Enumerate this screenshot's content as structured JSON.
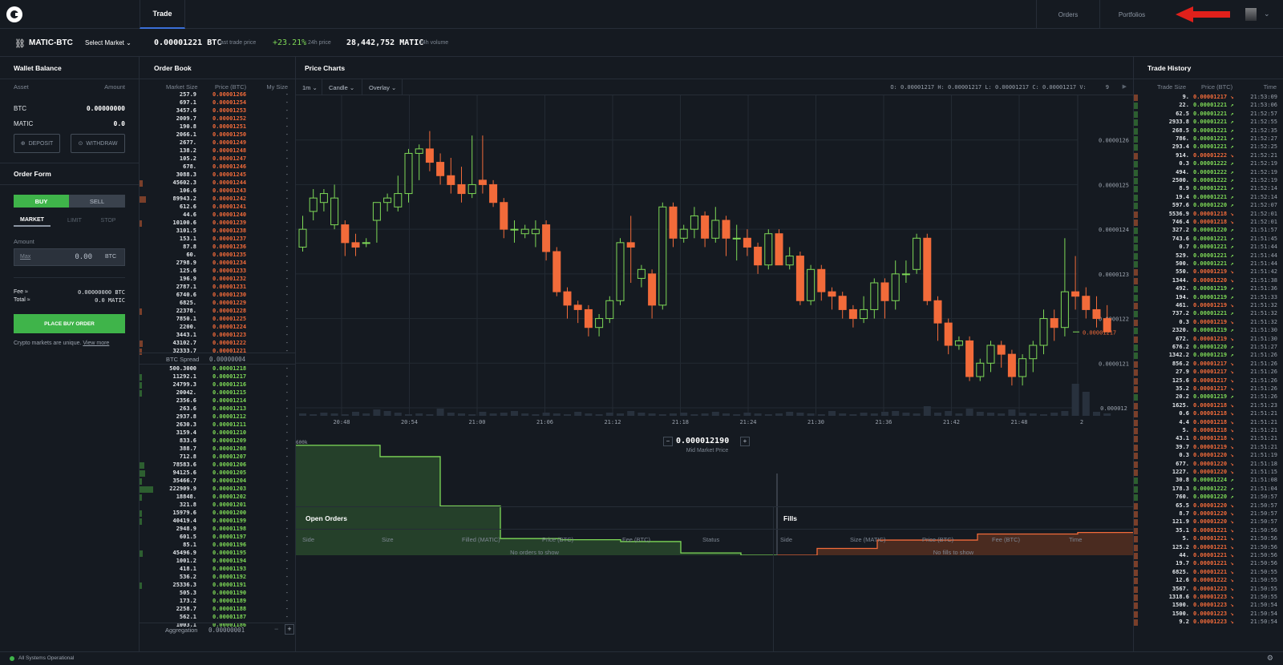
{
  "nav": {
    "tab_trade": "Trade",
    "orders": "Orders",
    "portfolios": "Portfolios"
  },
  "market": {
    "pair": "MATIC-BTC",
    "select_label": "Select Market",
    "last_price": "0.00001221 BTC",
    "last_price_label": "Last trade price",
    "change": "+23.21%",
    "change_label": "24h price",
    "volume": "28,442,752 MATIC",
    "volume_label": "24h volume"
  },
  "wallet": {
    "title": "Wallet Balance",
    "col_asset": "Asset",
    "col_amount": "Amount",
    "rows": [
      {
        "asset": "BTC",
        "amount": "0.00000000"
      },
      {
        "asset": "MATIC",
        "amount": "0.0"
      }
    ],
    "deposit": "DEPOSIT",
    "withdraw": "WITHDRAW"
  },
  "order_form": {
    "title": "Order Form",
    "buy": "BUY",
    "sell": "SELL",
    "market": "MARKET",
    "limit": "LIMIT",
    "stop": "STOP",
    "amount_label": "Amount",
    "max": "Max",
    "amount_value": "0.00",
    "amount_unit": "BTC",
    "fee_label": "Fee ≈",
    "fee_value": "0.00000000 BTC",
    "total_label": "Total ≈",
    "total_value": "0.0 MATIC",
    "place": "PLACE BUY ORDER",
    "note": "Crypto markets are unique.",
    "note_link": "View more"
  },
  "order_book": {
    "title": "Order Book",
    "col_size": "Market Size",
    "col_price": "Price (BTC)",
    "col_my": "My Size",
    "asks": [
      [
        "257.9",
        "0.00001266",
        0
      ],
      [
        "697.1",
        "0.00001254",
        0
      ],
      [
        "3457.6",
        "0.00001253",
        0
      ],
      [
        "2009.7",
        "0.00001252",
        0
      ],
      [
        "190.8",
        "0.00001251",
        0
      ],
      [
        "2066.1",
        "0.00001250",
        0
      ],
      [
        "2677.",
        "0.00001249",
        0
      ],
      [
        "138.2",
        "0.00001248",
        0
      ],
      [
        "105.2",
        "0.00001247",
        0
      ],
      [
        "678.",
        "0.00001246",
        0
      ],
      [
        "3088.3",
        "0.00001245",
        0
      ],
      [
        "45602.3",
        "0.00001244",
        0.04
      ],
      [
        "106.6",
        "0.00001243",
        0
      ],
      [
        "89943.2",
        "0.00001242",
        0.08
      ],
      [
        "612.6",
        "0.00001241",
        0
      ],
      [
        "44.6",
        "0.00001240",
        0
      ],
      [
        "10100.6",
        "0.00001239",
        0.01
      ],
      [
        "3101.5",
        "0.00001238",
        0
      ],
      [
        "153.1",
        "0.00001237",
        0
      ],
      [
        "87.8",
        "0.00001236",
        0
      ],
      [
        "60.",
        "0.00001235",
        0
      ],
      [
        "2798.9",
        "0.00001234",
        0
      ],
      [
        "125.6",
        "0.00001233",
        0
      ],
      [
        "196.9",
        "0.00001232",
        0
      ],
      [
        "2787.1",
        "0.00001231",
        0
      ],
      [
        "6740.6",
        "0.00001230",
        0
      ],
      [
        "6825.",
        "0.00001229",
        0
      ],
      [
        "22378.",
        "0.00001228",
        0.02
      ],
      [
        "7850.1",
        "0.00001225",
        0
      ],
      [
        "2200.",
        "0.00001224",
        0
      ],
      [
        "3443.1",
        "0.00001223",
        0
      ],
      [
        "43102.7",
        "0.00001222",
        0.04
      ],
      [
        "32333.7",
        "0.00001221",
        0.03
      ]
    ],
    "spread_label": "BTC Spread",
    "spread": "0.00000004",
    "bids": [
      [
        "500.3000",
        "0.00001218",
        0
      ],
      [
        "11292.1",
        "0.00001217",
        0.01
      ],
      [
        "24799.3",
        "0.00001216",
        0.02
      ],
      [
        "20042.",
        "0.00001215",
        0.02
      ],
      [
        "2356.6",
        "0.00001214",
        0
      ],
      [
        "263.6",
        "0.00001213",
        0
      ],
      [
        "2937.8",
        "0.00001212",
        0
      ],
      [
        "2630.3",
        "0.00001211",
        0
      ],
      [
        "3159.4",
        "0.00001210",
        0
      ],
      [
        "833.6",
        "0.00001209",
        0
      ],
      [
        "388.7",
        "0.00001208",
        0
      ],
      [
        "712.8",
        "0.00001207",
        0
      ],
      [
        "78583.6",
        "0.00001206",
        0.06
      ],
      [
        "94125.6",
        "0.00001205",
        0.07
      ],
      [
        "35466.7",
        "0.00001204",
        0.03
      ],
      [
        "222909.9",
        "0.00001203",
        0.17
      ],
      [
        "18848.",
        "0.00001202",
        0.02
      ],
      [
        "321.8",
        "0.00001201",
        0
      ],
      [
        "15979.6",
        "0.00001200",
        0.01
      ],
      [
        "40419.4",
        "0.00001199",
        0.03
      ],
      [
        "2948.9",
        "0.00001198",
        0
      ],
      [
        "601.5",
        "0.00001197",
        0
      ],
      [
        "85.1",
        "0.00001196",
        0
      ],
      [
        "45496.9",
        "0.00001195",
        0.04
      ],
      [
        "1001.2",
        "0.00001194",
        0
      ],
      [
        "418.1",
        "0.00001193",
        0
      ],
      [
        "536.2",
        "0.00001192",
        0
      ],
      [
        "25336.3",
        "0.00001191",
        0.02
      ],
      [
        "505.3",
        "0.00001190",
        0
      ],
      [
        "173.2",
        "0.00001189",
        0
      ],
      [
        "2258.7",
        "0.00001188",
        0
      ],
      [
        "562.1",
        "0.00001187",
        0
      ],
      [
        "1003.1",
        "0.00001186",
        0
      ]
    ],
    "my_size": "-",
    "aggregation_label": "Aggregation",
    "aggregation": "0.00000001",
    "minus": "−",
    "plus": "+"
  },
  "price_chart": {
    "title": "Price Charts",
    "interval": "1m",
    "type_label": "Candle",
    "overlay": "Overlay",
    "ohlc": "O: 0.00001217  H: 0.00001217  L: 0.00001217  C: 0.00001217  V:",
    "v_value": "9",
    "y_ticks": [
      "0.0000126",
      "0.0000125",
      "0.0000124",
      "0.0000123",
      "0.0000122",
      "0.0000121",
      "0.000012"
    ],
    "current_price": "0.00001217",
    "x_ticks": [
      "20:48",
      "20:54",
      "21:00",
      "21:06",
      "21:12",
      "21:18",
      "21:24",
      "21:30",
      "21:36",
      "21:42",
      "21:48",
      "2"
    ]
  },
  "depth": {
    "mid_price": "0.000012190",
    "mid_label": "Mid Market Price",
    "y_ticks": [
      "600k",
      "500k",
      "400k",
      "300k",
      "200k",
      "100k",
      "0"
    ]
  },
  "open_orders": {
    "title": "Open Orders",
    "cols": [
      "Side",
      "Size",
      "Filled (MATIC)",
      "Price (BTC)",
      "Fee (BTC)",
      "Status"
    ],
    "empty": "No orders to show"
  },
  "fills": {
    "title": "Fills",
    "cols": [
      "Side",
      "Size (MATIC)",
      "Price (BTC)",
      "Fee (BTC)",
      "Time"
    ],
    "empty": "No fills to show"
  },
  "trade_history": {
    "title": "Trade History",
    "col_size": "Trade Size",
    "col_price": "Price (BTC)",
    "col_time": "Time",
    "rows": [
      [
        "9.",
        "0.00001217",
        "d",
        "21:53:09"
      ],
      [
        "22.",
        "0.00001221",
        "u",
        "21:53:06"
      ],
      [
        "62.5",
        "0.00001221",
        "u",
        "21:52:57"
      ],
      [
        "2933.8",
        "0.00001221",
        "u",
        "21:52:55"
      ],
      [
        "268.5",
        "0.00001221",
        "u",
        "21:52:35"
      ],
      [
        "786.",
        "0.00001221",
        "u",
        "21:52:27"
      ],
      [
        "293.4",
        "0.00001221",
        "u",
        "21:52:25"
      ],
      [
        "914.",
        "0.00001222",
        "d",
        "21:52:21"
      ],
      [
        "0.3",
        "0.00001222",
        "u",
        "21:52:19"
      ],
      [
        "494.",
        "0.00001222",
        "u",
        "21:52:19"
      ],
      [
        "2500.",
        "0.00001222",
        "u",
        "21:52:19"
      ],
      [
        "8.9",
        "0.00001221",
        "u",
        "21:52:14"
      ],
      [
        "19.4",
        "0.00001221",
        "u",
        "21:52:14"
      ],
      [
        "597.6",
        "0.00001220",
        "u",
        "21:52:07"
      ],
      [
        "5536.9",
        "0.00001218",
        "d",
        "21:52:01"
      ],
      [
        "746.4",
        "0.00001218",
        "d",
        "21:52:01"
      ],
      [
        "327.2",
        "0.00001220",
        "u",
        "21:51:57"
      ],
      [
        "743.6",
        "0.00001221",
        "u",
        "21:51:45"
      ],
      [
        "0.7",
        "0.00001221",
        "u",
        "21:51:44"
      ],
      [
        "529.",
        "0.00001221",
        "u",
        "21:51:44"
      ],
      [
        "500.",
        "0.00001221",
        "u",
        "21:51:44"
      ],
      [
        "550.",
        "0.00001219",
        "d",
        "21:51:42"
      ],
      [
        "1344.",
        "0.00001220",
        "d",
        "21:51:38"
      ],
      [
        "492.",
        "0.00001219",
        "u",
        "21:51:36"
      ],
      [
        "194.",
        "0.00001219",
        "u",
        "21:51:33"
      ],
      [
        "461.",
        "0.00001219",
        "d",
        "21:51:32"
      ],
      [
        "737.2",
        "0.00001221",
        "u",
        "21:51:32"
      ],
      [
        "0.3",
        "0.00001219",
        "d",
        "21:51:32"
      ],
      [
        "2320.",
        "0.00001219",
        "u",
        "21:51:30"
      ],
      [
        "672.",
        "0.00001219",
        "d",
        "21:51:30"
      ],
      [
        "676.2",
        "0.00001220",
        "u",
        "21:51:27"
      ],
      [
        "1342.2",
        "0.00001219",
        "u",
        "21:51:26"
      ],
      [
        "856.2",
        "0.00001217",
        "d",
        "21:51:26"
      ],
      [
        "27.9",
        "0.00001217",
        "d",
        "21:51:26"
      ],
      [
        "125.6",
        "0.00001217",
        "d",
        "21:51:26"
      ],
      [
        "35.2",
        "0.00001217",
        "d",
        "21:51:26"
      ],
      [
        "20.2",
        "0.00001219",
        "u",
        "21:51:26"
      ],
      [
        "1625.",
        "0.00001218",
        "d",
        "21:51:23"
      ],
      [
        "0.6",
        "0.00001218",
        "d",
        "21:51:21"
      ],
      [
        "4.4",
        "0.00001218",
        "d",
        "21:51:21"
      ],
      [
        "5.",
        "0.00001218",
        "d",
        "21:51:21"
      ],
      [
        "43.1",
        "0.00001218",
        "d",
        "21:51:21"
      ],
      [
        "39.7",
        "0.00001219",
        "d",
        "21:51:21"
      ],
      [
        "0.3",
        "0.00001220",
        "d",
        "21:51:19"
      ],
      [
        "677.",
        "0.00001220",
        "d",
        "21:51:18"
      ],
      [
        "1227.",
        "0.00001220",
        "d",
        "21:51:15"
      ],
      [
        "30.8",
        "0.00001224",
        "u",
        "21:51:08"
      ],
      [
        "178.3",
        "0.00001222",
        "u",
        "21:51:04"
      ],
      [
        "760.",
        "0.00001220",
        "u",
        "21:50:57"
      ],
      [
        "65.5",
        "0.00001220",
        "d",
        "21:50:57"
      ],
      [
        "8.7",
        "0.00001220",
        "d",
        "21:50:57"
      ],
      [
        "121.9",
        "0.00001220",
        "d",
        "21:50:57"
      ],
      [
        "35.1",
        "0.00001221",
        "d",
        "21:50:56"
      ],
      [
        "5.",
        "0.00001221",
        "d",
        "21:50:56"
      ],
      [
        "125.2",
        "0.00001221",
        "d",
        "21:50:56"
      ],
      [
        "44.",
        "0.00001221",
        "d",
        "21:50:56"
      ],
      [
        "19.7",
        "0.00001221",
        "d",
        "21:50:56"
      ],
      [
        "6825.",
        "0.00001221",
        "d",
        "21:50:55"
      ],
      [
        "12.6",
        "0.00001222",
        "d",
        "21:50:55"
      ],
      [
        "3567.",
        "0.00001223",
        "d",
        "21:50:55"
      ],
      [
        "1318.6",
        "0.00001223",
        "d",
        "21:50:55"
      ],
      [
        "1500.",
        "0.00001223",
        "d",
        "21:50:54"
      ],
      [
        "1500.",
        "0.00001223",
        "d",
        "21:50:54"
      ],
      [
        "9.2",
        "0.00001223",
        "d",
        "21:50:54"
      ]
    ]
  },
  "footer": {
    "status": "All Systems Operational"
  },
  "colors": {
    "green": "#7ed957",
    "red": "#f26b3a",
    "buy": "#3fb44a",
    "accent": "#3a6fd8"
  }
}
